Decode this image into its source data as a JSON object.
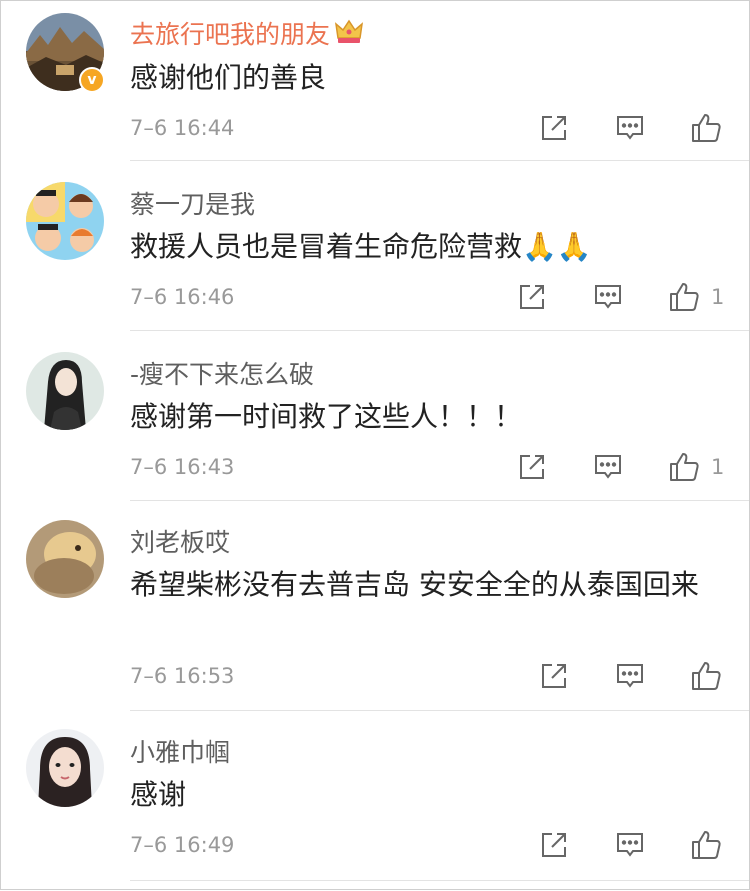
{
  "comments": [
    {
      "name": "去旅行吧我的朋友",
      "text": "感谢他们的善良",
      "time": "7–6 16:44",
      "likes": "",
      "vip": true,
      "verified": true,
      "avatar_icon": "landscape-photo"
    },
    {
      "name": "蔡一刀是我",
      "text": "救援人员也是冒着生命危险营救🙏🙏",
      "time": "7–6 16:46",
      "likes": "1",
      "vip": false,
      "verified": false,
      "avatar_icon": "cartoon-family"
    },
    {
      "name": "-瘦不下来怎么破",
      "text": "感谢第一时间救了这些人！！！",
      "time": "7–6 16:43",
      "likes": "1",
      "vip": false,
      "verified": false,
      "avatar_icon": "illustrated-girl"
    },
    {
      "name": "刘老板哎",
      "text": "希望柴彬没有去普吉岛 安安全全的从泰国回来",
      "time": "7–6 16:53",
      "likes": "",
      "vip": false,
      "verified": false,
      "avatar_icon": "pet-photo"
    },
    {
      "name": "小雅巾帼",
      "text": "感谢",
      "time": "7–6 16:49",
      "likes": "",
      "vip": false,
      "verified": false,
      "avatar_icon": "portrait-photo"
    }
  ],
  "icons": {
    "share": "share-icon",
    "reply": "comment-icon",
    "like": "thumbs-up-icon",
    "crown": "crown-icon",
    "verified": "verified-v-icon"
  },
  "colors": {
    "vip_name": "#eb7350",
    "name": "#5f5f5f",
    "meta": "#999999",
    "badge": "#f6a623"
  }
}
